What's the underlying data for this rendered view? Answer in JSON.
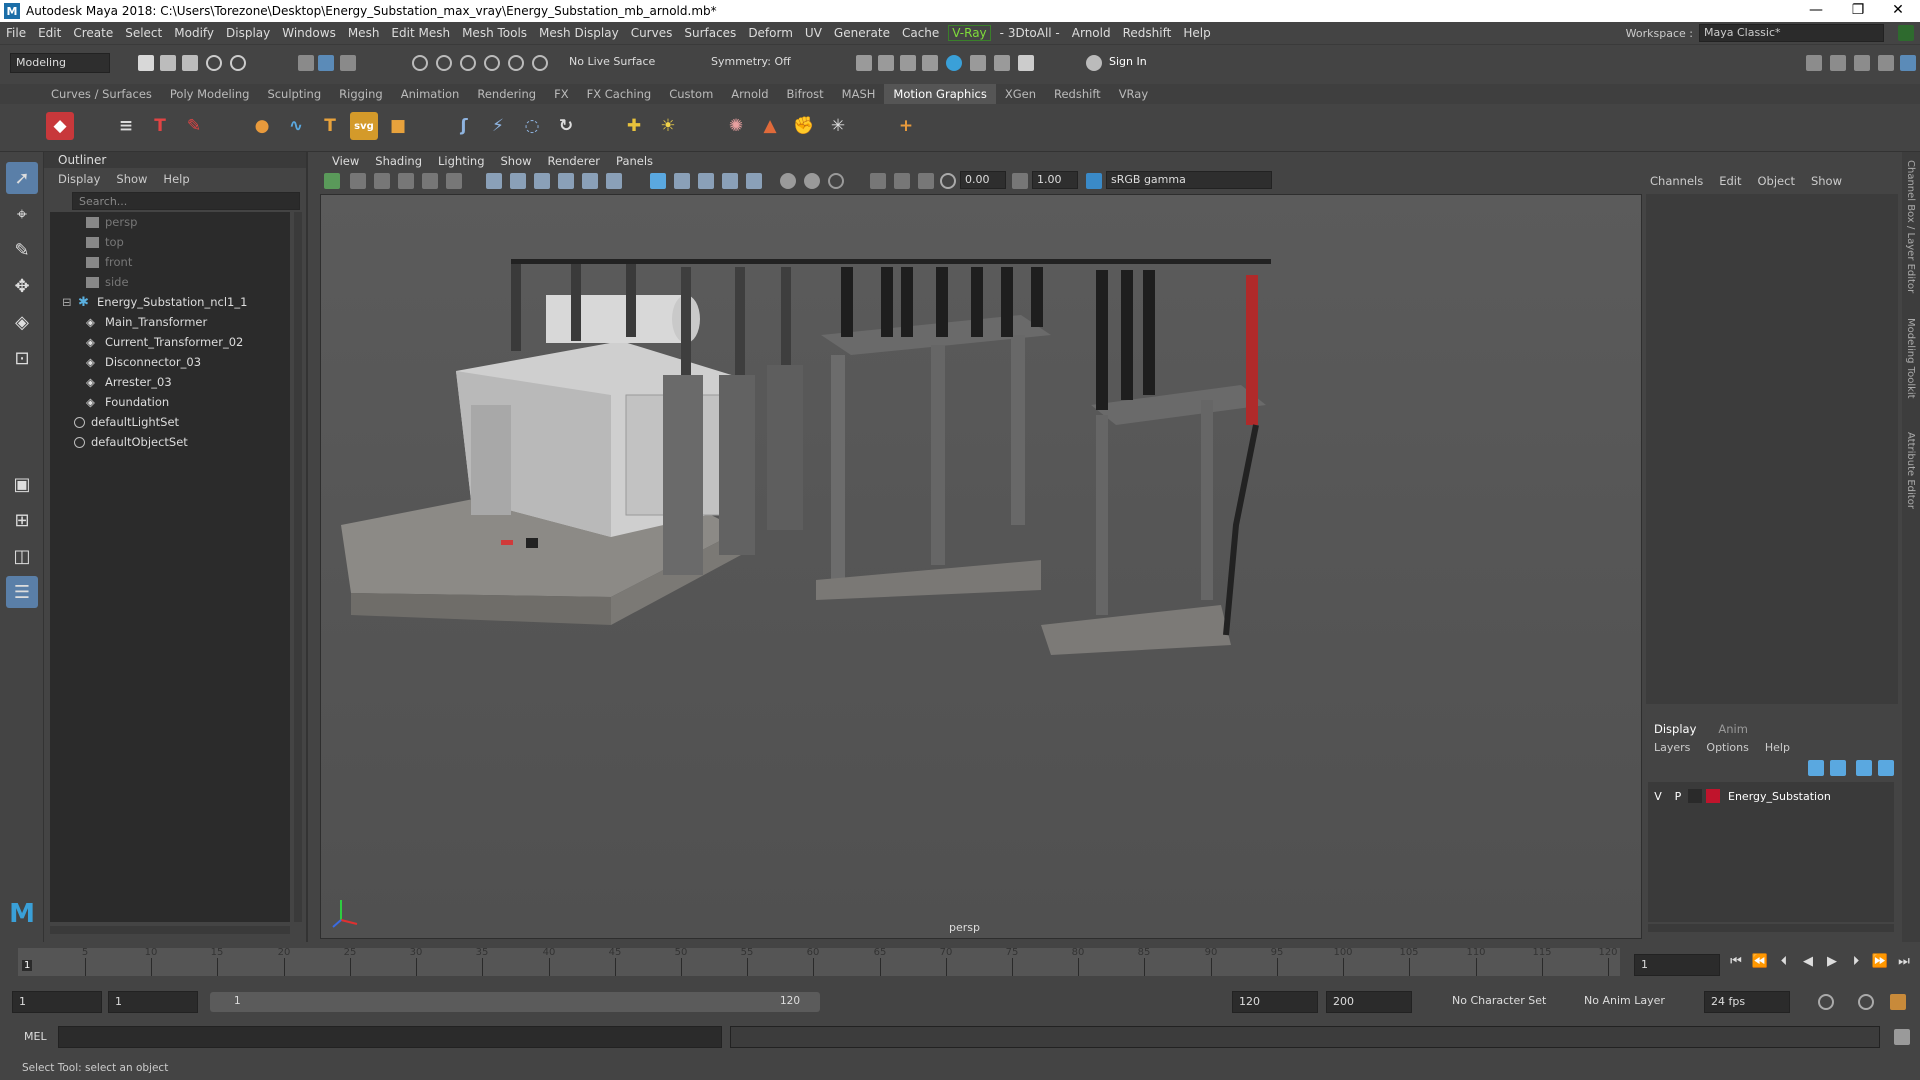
{
  "title": "Autodesk Maya 2018: C:\\Users\\Torezone\\Desktop\\Energy_Substation_max_vray\\Energy_Substation_mb_arnold.mb*",
  "window_controls": {
    "minimize": "—",
    "restore": "❐",
    "close": "✕"
  },
  "menubar": [
    "File",
    "Edit",
    "Create",
    "Select",
    "Modify",
    "Display",
    "Windows",
    "Mesh",
    "Edit Mesh",
    "Mesh Tools",
    "Mesh Display",
    "Curves",
    "Surfaces",
    "Deform",
    "UV",
    "Generate",
    "Cache"
  ],
  "menubar_vray": "V-Ray",
  "menubar_rest": [
    "- 3DtoAll -",
    "Arnold",
    "Redshift",
    "Help"
  ],
  "workspace_label": "Workspace :",
  "workspace_value": "Maya Classic*",
  "statusline": {
    "mode": "Modeling",
    "live_surface": "No Live Surface",
    "symmetry": "Symmetry: Off",
    "sign_in": "Sign In"
  },
  "shelf_tabs": [
    "Curves / Surfaces",
    "Poly Modeling",
    "Sculpting",
    "Rigging",
    "Animation",
    "Rendering",
    "FX",
    "FX Caching",
    "Custom",
    "Arnold",
    "Bifrost",
    "MASH",
    "Motion Graphics",
    "XGen",
    "Redshift",
    "VRay"
  ],
  "shelf_active": "Motion Graphics",
  "outliner": {
    "title": "Outliner",
    "menu": [
      "Display",
      "Show",
      "Help"
    ],
    "search_placeholder": "Search...",
    "cameras": [
      "persp",
      "top",
      "front",
      "side"
    ],
    "group": "Energy_Substation_ncl1_1",
    "children": [
      "Main_Transformer",
      "Current_Transformer_02",
      "Disconnector_03",
      "Arrester_03",
      "Foundation"
    ],
    "sets": [
      "defaultLightSet",
      "defaultObjectSet"
    ]
  },
  "viewport": {
    "menu": [
      "View",
      "Shading",
      "Lighting",
      "Show",
      "Renderer",
      "Panels"
    ],
    "exposure": "0.00",
    "gamma": "1.00",
    "colorspace": "sRGB gamma",
    "camera_label": "persp"
  },
  "channelbox": {
    "menu": [
      "Channels",
      "Edit",
      "Object",
      "Show"
    ],
    "layer_tabs": [
      "Display",
      "Anim"
    ],
    "layer_menu": [
      "Layers",
      "Options",
      "Help"
    ],
    "layer": {
      "v": "V",
      "p": "P",
      "name": "Energy_Substation",
      "color": "#c0142c"
    }
  },
  "side_tabs": [
    "Channel Box / Layer Editor",
    "Modeling Toolkit",
    "Attribute Editor"
  ],
  "timeline": {
    "ticks": [
      "5",
      "10",
      "15",
      "20",
      "25",
      "30",
      "35",
      "40",
      "45",
      "50",
      "55",
      "60",
      "65",
      "70",
      "75",
      "80",
      "85",
      "90",
      "95",
      "100",
      "105",
      "110",
      "115",
      "120"
    ],
    "first": "1",
    "current_frame": "1"
  },
  "range": {
    "start": "1",
    "playback_start": "1",
    "slider_start": "1",
    "slider_end": "120",
    "playback_end": "120",
    "end": "200",
    "character_set": "No Character Set",
    "anim_layer": "No Anim Layer",
    "fps": "24 fps"
  },
  "cmdline": {
    "label": "MEL"
  },
  "help_line": "Select Tool: select an object"
}
